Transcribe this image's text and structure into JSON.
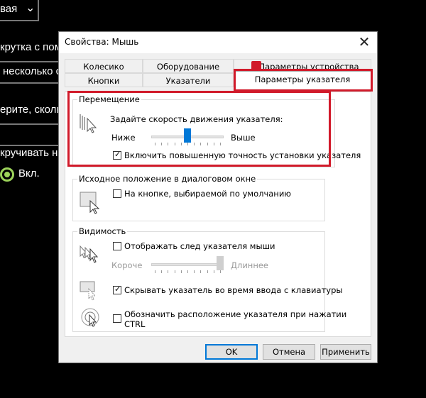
{
  "background": {
    "dropdown_text": "вая",
    "line1": "крутка с пом",
    "field_text": "несколько с",
    "line2": "ерите, сколь",
    "line3": "кручивать н",
    "toggle_label": "Вкл."
  },
  "dialog": {
    "title": "Свойства: Мышь",
    "close_glyph": "✕",
    "tabs_top": [
      "Колесико",
      "Оборудование",
      "Параметры устройства"
    ],
    "tabs_bottom": [
      "Кнопки",
      "Указатели",
      "Параметры указателя"
    ],
    "selected_tab": "Параметры указателя",
    "motion": {
      "legend": "Перемещение",
      "speed_label": "Задайте скорость движения указателя:",
      "slow": "Ниже",
      "fast": "Выше",
      "speed_level": 0.5,
      "precision_label": "Включить повышенную точность установки указателя",
      "precision_checked": true
    },
    "snap": {
      "legend": "Исходное положение в диалоговом окне",
      "label": "На кнопке, выбираемой по умолчанию",
      "checked": false
    },
    "visibility": {
      "legend": "Видимость",
      "trails_label": "Отображать след указателя мыши",
      "trails_checked": false,
      "short": "Короче",
      "long": "Длиннее",
      "trails_level": 1.0,
      "hide_label": "Скрывать указатель во время ввода с клавиатуры",
      "hide_checked": true,
      "ctrl_label_line1": "Обозначить расположение указателя при нажатии",
      "ctrl_label_line2": "CTRL",
      "ctrl_checked": false
    },
    "buttons": {
      "ok": "OK",
      "cancel": "Отмена",
      "apply": "Применить"
    }
  },
  "colors": {
    "accent": "#0078d7",
    "highlight": "#d11a2a",
    "toggle": "#9cd35a"
  }
}
